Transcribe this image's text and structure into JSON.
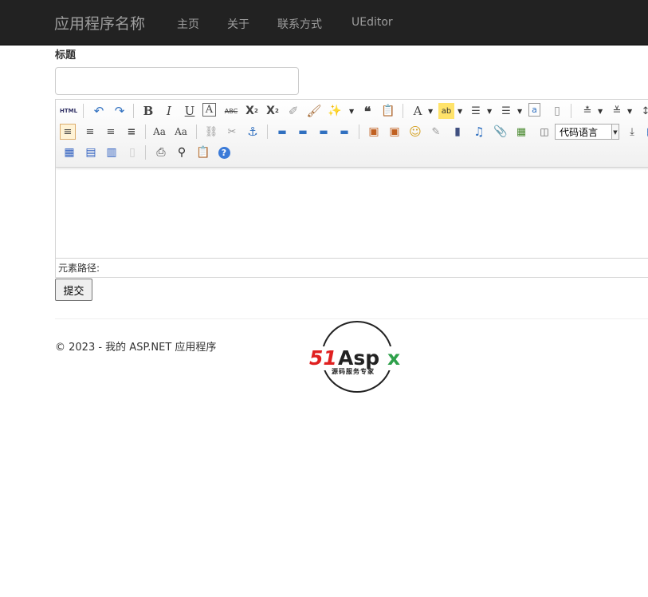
{
  "navbar": {
    "brand": "应用程序名称",
    "links": [
      "主页",
      "关于",
      "联系方式",
      "UEditor"
    ]
  },
  "form": {
    "title_label": "标题",
    "title_value": "",
    "submit_label": "提交"
  },
  "editor": {
    "html_label": "HTML",
    "code_language": "代码语言",
    "status_text": "元素路径:"
  },
  "footer": {
    "copyright": "© 2023 - 我的 ASP.NET 应用程序"
  },
  "logo": {
    "brand_text": "51Aspx",
    "tagline": "源码服务专家"
  },
  "colors": {
    "navbar_bg": "#222222",
    "nav_text": "#9d9d9d",
    "logo_red": "#e02020",
    "logo_green": "#2ea04a"
  }
}
